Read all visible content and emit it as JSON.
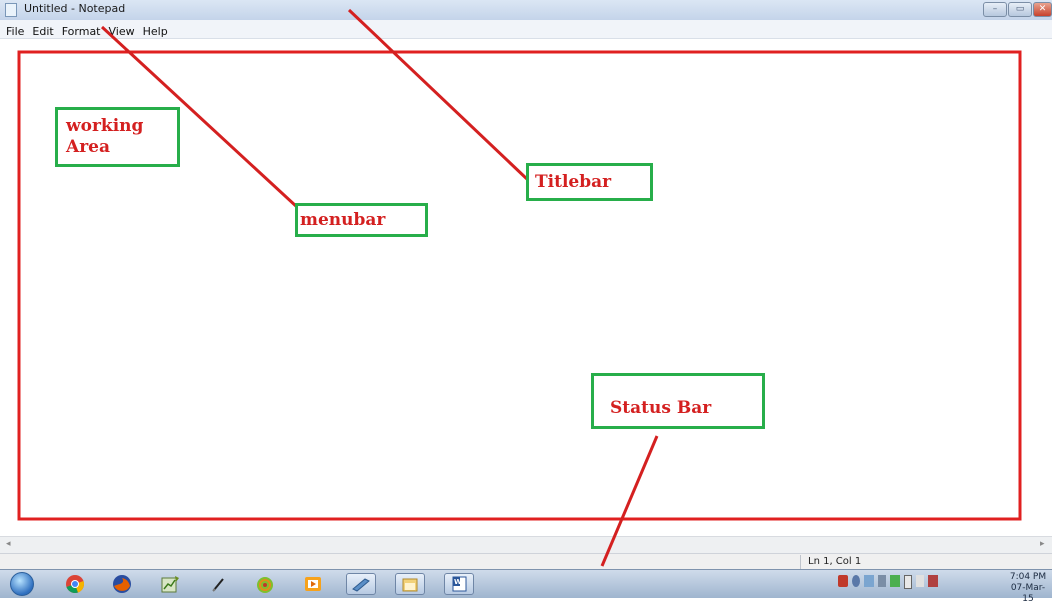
{
  "window": {
    "title": "Untitled - Notepad",
    "minimize_glyph": "–",
    "maximize_glyph": "▭",
    "close_glyph": "✕"
  },
  "menubar": {
    "items": [
      "File",
      "Edit",
      "Format",
      "View",
      "Help"
    ]
  },
  "statusbar": {
    "position": "Ln 1, Col 1"
  },
  "scrollbar": {
    "left_arrow": "◂",
    "right_arrow": "▸"
  },
  "taskbar": {
    "apps": [
      "chrome-icon",
      "firefox-icon",
      "chart-app-icon",
      "pen-icon",
      "chameleon-icon",
      "media-player-icon",
      "window-app-icon",
      "folder-icon",
      "word-icon"
    ],
    "tray_icons": [
      "shield-icon",
      "bluetooth-icon",
      "network-icon",
      "volume-icon",
      "tray-app-icon",
      "battery-icon",
      "flag-icon",
      "monitor-icon"
    ],
    "time": "7:04 PM",
    "date": "07-Mar-15"
  },
  "annotations": {
    "working_area_line1": "working",
    "working_area_line2": "Area",
    "menubar": "menubar",
    "titlebar": "Titlebar",
    "status_bar": "Status Bar"
  },
  "colors": {
    "annotation_text": "#d42020",
    "annotation_box": "#27ae4a",
    "annotation_frame": "#e02020"
  }
}
